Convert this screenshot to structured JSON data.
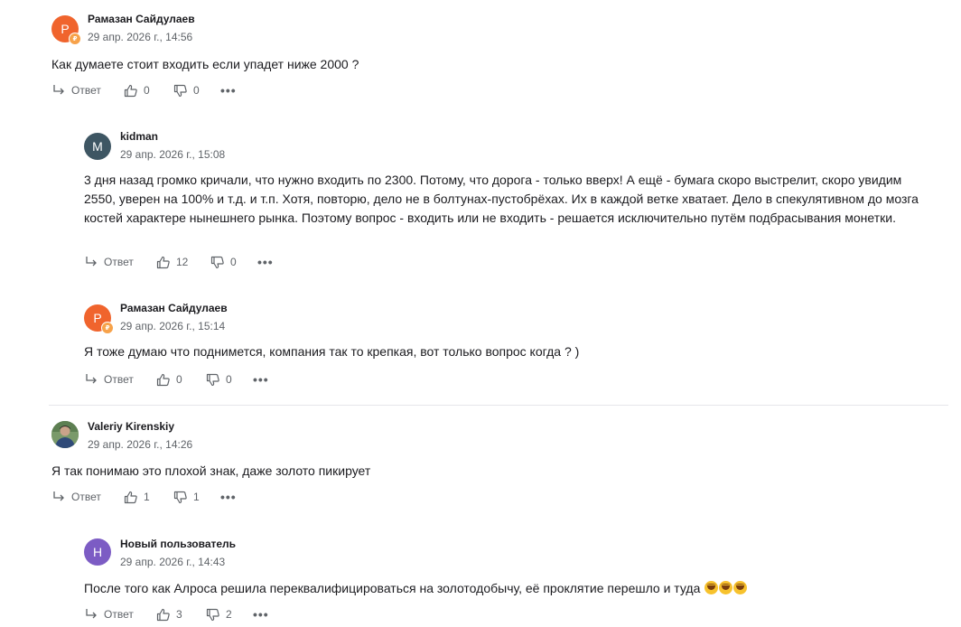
{
  "labels": {
    "reply": "Ответ"
  },
  "comments": [
    {
      "author": "Рамазан Сайдулаев",
      "avatar_letter": "Р",
      "avatar_color": "#f0642d",
      "date": "29 апр. 2026 г., 14:56",
      "text": "Как думаете стоит входить если упадет ниже 2000 ?",
      "likes": "0",
      "dislikes": "0"
    },
    {
      "author": "kidman",
      "avatar_letter": "M",
      "avatar_color": "#3e5663",
      "date": "29 апр. 2026 г., 15:08",
      "text": "3 дня назад громко кричали, что нужно входить по 2300. Потому, что дорога - только вверх! А ещё - бумага скоро выстрелит, скоро увидим 2550, уверен на 100% и т.д. и т.п. Хотя, повторю, дело не в болтунах-пустобрёхах. Их в каждой ветке хватает. Дело в спекулятивном до мозга костей характере нынешнего рынка. Поэтому вопрос - входить или не входить - решается исключительно путём подбрасывания монетки.",
      "likes": "12",
      "dislikes": "0"
    },
    {
      "author": "Рамазан Сайдулаев",
      "avatar_letter": "Р",
      "avatar_color": "#f0642d",
      "date": "29 апр. 2026 г., 15:14",
      "text": "Я тоже думаю что поднимется, компания так то крепкая, вот только вопрос когда ? )",
      "likes": "0",
      "dislikes": "0"
    },
    {
      "author": "Valeriy Kirenskiy",
      "avatar_color": "#4a6b4a",
      "date": "29 апр. 2026 г., 14:26",
      "text": "Я так понимаю это плохой знак, даже золото пикирует",
      "likes": "1",
      "dislikes": "1"
    },
    {
      "author": "Новый пользователь",
      "avatar_letter": "Н",
      "avatar_color": "#7c5cc4",
      "date": "29 апр. 2026 г., 14:43",
      "text": "После того как Алроса решила переквалифицироваться на золотодобычу, её проклятие перешло и туда",
      "likes": "3",
      "dislikes": "2"
    }
  ]
}
